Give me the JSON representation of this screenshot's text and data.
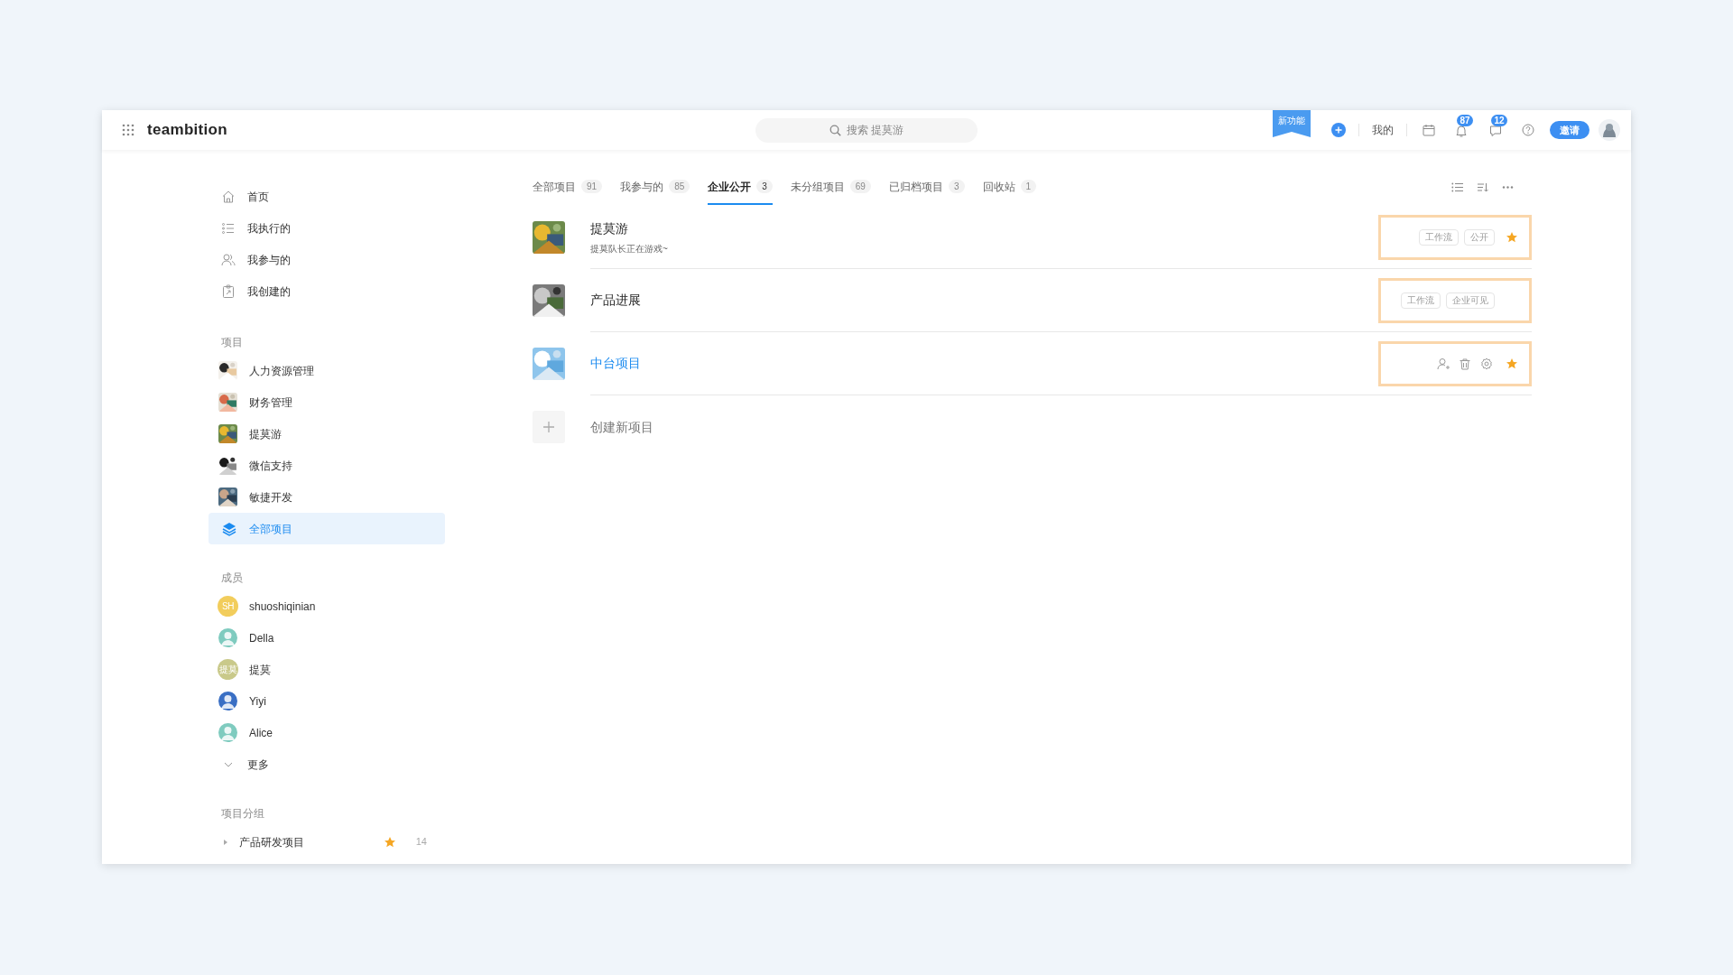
{
  "topbar": {
    "logo": "teambition",
    "search": {
      "placeholder": "搜索 提莫游"
    },
    "new_feature": "新功能",
    "my": "我的",
    "notifications": "87",
    "messages": "12",
    "invite": "邀请"
  },
  "sidebar": {
    "nav": [
      {
        "label": "首页",
        "kind": "home",
        "selected": false
      },
      {
        "label": "我执行的",
        "kind": "tasks",
        "selected": false
      },
      {
        "label": "我参与的",
        "kind": "people",
        "selected": false
      },
      {
        "label": "我创建的",
        "kind": "clipboard",
        "selected": false
      }
    ],
    "projects_heading": "项目",
    "projects": [
      {
        "label": "人力资源管理",
        "selected": false
      },
      {
        "label": "财务管理",
        "selected": false
      },
      {
        "label": "提莫游",
        "selected": false
      },
      {
        "label": "微信支持",
        "selected": false
      },
      {
        "label": "敏捷开发",
        "selected": false
      },
      {
        "label": "全部项目",
        "selected": true,
        "kind": "all"
      }
    ],
    "members_heading": "成员",
    "members": [
      {
        "name": "shuoshiqinian",
        "kind": "initials",
        "initials": "SH",
        "color": "#f2cd5c"
      },
      {
        "name": "Della",
        "kind": "picture"
      },
      {
        "name": "提莫",
        "kind": "initials",
        "initials": "提莫",
        "color": "#c9c98a"
      },
      {
        "name": "Yiyi",
        "kind": "picture"
      },
      {
        "name": "Alice",
        "kind": "picture"
      }
    ],
    "more": "更多",
    "groups_heading": "项目分组",
    "groups": [
      {
        "label": "产品研发项目",
        "expanded": false,
        "starred": true,
        "count": "14"
      }
    ]
  },
  "tabs": [
    {
      "label": "全部项目",
      "count": "91",
      "selected": false
    },
    {
      "label": "我参与的",
      "count": "85",
      "selected": false
    },
    {
      "label": "企业公开",
      "count": "3",
      "selected": true
    },
    {
      "label": "未分组项目",
      "count": "69",
      "selected": false
    },
    {
      "label": "已归档项目",
      "count": "3",
      "selected": false
    },
    {
      "label": "回收站",
      "count": "1",
      "selected": false
    }
  ],
  "projects": [
    {
      "name": "提莫游",
      "description": "提莫队长正在游戏~",
      "hovered": false,
      "highlighted": true,
      "starred": true,
      "tags": [
        "工作流",
        "公开"
      ]
    },
    {
      "name": "产品进展",
      "hovered": false,
      "highlighted": true,
      "starred": false,
      "tags": [
        "工作流",
        "企业可见"
      ]
    },
    {
      "name": "中台项目",
      "hovered": true,
      "highlighted": true,
      "starred": true
    }
  ],
  "create_project": "创建新项目"
}
